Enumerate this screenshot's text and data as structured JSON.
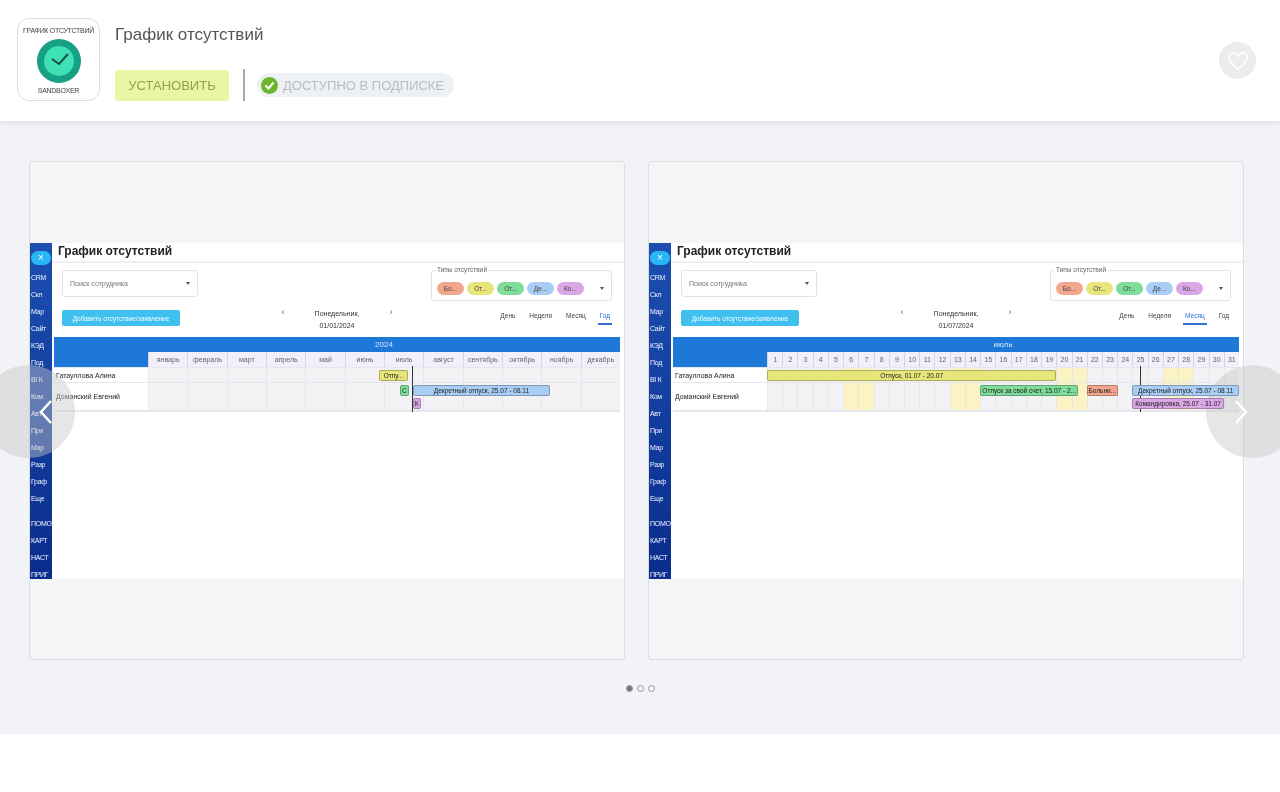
{
  "app": {
    "title": "График отсутствий",
    "icon_caption_top": "ГРАФИК ОТСУТСТВИЙ",
    "icon_caption_bottom": "SANDBOXER",
    "install_button": "УСТАНОВИТЬ",
    "subscription_badge": "ДОСТУПНО В ПОДПИСКЕ",
    "favorite": false
  },
  "slides": [
    {
      "close": "×",
      "sidebar_items": [
        "CRM",
        "Скл",
        "Мар",
        "Сайт",
        "КЭД",
        "Под",
        "BI К",
        "Ком",
        "Авт",
        "При",
        "Мар",
        "Разр",
        "Граф",
        "Еще"
      ],
      "sidebar_footer": [
        "ПОМО",
        "КАРТ",
        "НАСТ",
        "ПРИГ"
      ],
      "title": "График отсутствий",
      "search_placeholder": "Поиск сотрудника",
      "types_label": "Типы отсутствий",
      "types": [
        {
          "label": "Бо...",
          "color": "#f2a68e"
        },
        {
          "label": "От...",
          "color": "#e8e57a"
        },
        {
          "label": "От...",
          "color": "#7fdc9a"
        },
        {
          "label": "Де...",
          "color": "#a9cdf5"
        },
        {
          "label": "Ко...",
          "color": "#dba6e6"
        }
      ],
      "add_button": "Добавить отсутствие/заявление",
      "prev": "‹",
      "next": "›",
      "date_line1": "Понедельник,",
      "date_line2": "01/01/2024",
      "views": [
        {
          "label": "День",
          "selected": false
        },
        {
          "label": "Неделя",
          "selected": false
        },
        {
          "label": "Месяц",
          "selected": false
        },
        {
          "label": "Год",
          "selected": true
        }
      ],
      "period": "2024",
      "columns": [
        {
          "label": "январь",
          "weekend": false
        },
        {
          "label": "февраль",
          "weekend": false
        },
        {
          "label": "март",
          "weekend": false
        },
        {
          "label": "апрель",
          "weekend": false
        },
        {
          "label": "май",
          "weekend": false
        },
        {
          "label": "июнь",
          "weekend": false
        },
        {
          "label": "июль",
          "weekend": false
        },
        {
          "label": "август",
          "weekend": false
        },
        {
          "label": "сентябрь",
          "weekend": false
        },
        {
          "label": "октябрь",
          "weekend": false
        },
        {
          "label": "ноябрь",
          "weekend": false
        },
        {
          "label": "декабрь",
          "weekend": false
        }
      ],
      "rows": [
        {
          "name": "Гатауллова Алина",
          "bars": [
            {
              "label": "Отпу...",
              "color": "#e6e67a"
            }
          ]
        },
        {
          "name": "Доманский Евгений",
          "bars": [
            {
              "label": "С",
              "color": "#7fdc9a"
            },
            {
              "label": "Декретный отпуск, 25.07 - 08.11",
              "color": "#a9cdf5"
            },
            {
              "label": "К",
              "color": "#dba6e6"
            }
          ]
        }
      ]
    },
    {
      "close": "×",
      "sidebar_items": [
        "CRM",
        "Скл",
        "Мар",
        "Сайт",
        "КЭД",
        "Под",
        "BI К",
        "Ком",
        "Авт",
        "При",
        "Мар",
        "Разр",
        "Граф",
        "Еще"
      ],
      "sidebar_footer": [
        "ПОМО",
        "КАРТ",
        "НАСТ",
        "ПРИГ"
      ],
      "title": "График отсутствий",
      "search_placeholder": "Поиск сотрудника",
      "types_label": "Типы отсутствий",
      "types": [
        {
          "label": "Бо...",
          "color": "#f2a68e"
        },
        {
          "label": "От...",
          "color": "#e8e57a"
        },
        {
          "label": "От...",
          "color": "#7fdc9a"
        },
        {
          "label": "Де...",
          "color": "#a9cdf5"
        },
        {
          "label": "Ко...",
          "color": "#dba6e6"
        }
      ],
      "add_button": "Добавить отсутствие/заявление",
      "prev": "‹",
      "next": "›",
      "date_line1": "Понедельник,",
      "date_line2": "01/07/2024",
      "views": [
        {
          "label": "День",
          "selected": false
        },
        {
          "label": "Неделя",
          "selected": false
        },
        {
          "label": "Месяц",
          "selected": true
        },
        {
          "label": "Год",
          "selected": false
        }
      ],
      "period": "июль",
      "columns": [
        {
          "label": "1",
          "weekend": false
        },
        {
          "label": "2",
          "weekend": false
        },
        {
          "label": "3",
          "weekend": false
        },
        {
          "label": "4",
          "weekend": false
        },
        {
          "label": "5",
          "weekend": false
        },
        {
          "label": "6",
          "weekend": true
        },
        {
          "label": "7",
          "weekend": true
        },
        {
          "label": "8",
          "weekend": false
        },
        {
          "label": "9",
          "weekend": false
        },
        {
          "label": "10",
          "weekend": false
        },
        {
          "label": "11",
          "weekend": false
        },
        {
          "label": "12",
          "weekend": false
        },
        {
          "label": "13",
          "weekend": true
        },
        {
          "label": "14",
          "weekend": true
        },
        {
          "label": "15",
          "weekend": false
        },
        {
          "label": "16",
          "weekend": false
        },
        {
          "label": "17",
          "weekend": false
        },
        {
          "label": "18",
          "weekend": false
        },
        {
          "label": "19",
          "weekend": false
        },
        {
          "label": "20",
          "weekend": true
        },
        {
          "label": "21",
          "weekend": true
        },
        {
          "label": "22",
          "weekend": false
        },
        {
          "label": "23",
          "weekend": false
        },
        {
          "label": "24",
          "weekend": false
        },
        {
          "label": "25",
          "weekend": false
        },
        {
          "label": "26",
          "weekend": false
        },
        {
          "label": "27",
          "weekend": true
        },
        {
          "label": "28",
          "weekend": true
        },
        {
          "label": "29",
          "weekend": false
        },
        {
          "label": "30",
          "weekend": false
        },
        {
          "label": "31",
          "weekend": false
        }
      ],
      "rows": [
        {
          "name": "Гатауллова Алина",
          "bars": [
            {
              "label": "Отпуск, 01.07 - 20.07",
              "color": "#e6e67a"
            }
          ]
        },
        {
          "name": "Доманский Евгений",
          "bars": [
            {
              "label": "Отпуск за свой счет, 15.07 - 2...",
              "color": "#7fdc9a"
            },
            {
              "label": "Больни...",
              "color": "#f2a68e"
            },
            {
              "label": "Декретный отпуск, 25.07 - 08.11",
              "color": "#a9cdf5"
            },
            {
              "label": "Командировка, 25.07 - 31.07",
              "color": "#dba6e6"
            }
          ]
        }
      ]
    }
  ],
  "carousel_dots": [
    {
      "selected": true
    },
    {
      "selected": false
    },
    {
      "selected": false
    }
  ]
}
